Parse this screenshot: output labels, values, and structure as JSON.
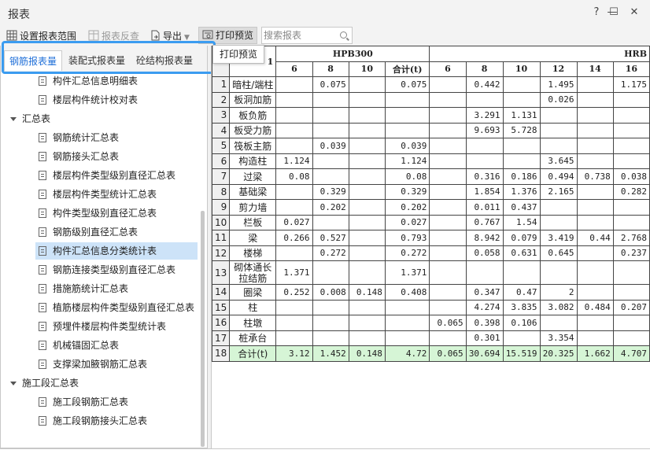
{
  "window": {
    "title": "报表"
  },
  "toolbar": {
    "set_range": "设置报表范围",
    "reverse_check": "报表反查",
    "export": "导出",
    "print_preview": "打印预览",
    "search_placeholder": "搜索报表"
  },
  "tooltip": "打印预览",
  "tabs": [
    "钢筋报表量",
    "装配式报表量",
    "砼结构报表量"
  ],
  "tree": {
    "items_top": [
      "构件汇总信息明细表",
      "楼层构件统计校对表"
    ],
    "group_summary": "汇总表",
    "summary_items": [
      "钢筋统计汇总表",
      "钢筋接头汇总表",
      "楼层构件类型级别直径汇总表",
      "楼层构件类型统计汇总表",
      "构件类型级别直径汇总表",
      "钢筋级别直径汇总表",
      "构件汇总信息分类统计表",
      "钢筋连接类型级别直径汇总表",
      "措施筋统计汇总表",
      "植筋楼层构件类型级别直径汇总表",
      "预埋件楼层构件类型统计表",
      "机械锚固汇总表",
      "支撑梁加腋钢筋汇总表"
    ],
    "group_stage": "施工段汇总表",
    "stage_items": [
      "施工段钢筋汇总表",
      "施工段钢筋接头汇总表"
    ],
    "selected": "构件汇总信息分类统计表"
  },
  "table": {
    "corner_fragment": "1",
    "group_hpb": "HPB300",
    "group_hrb": "HRB",
    "sub_headers": [
      "6",
      "8",
      "10",
      "合计(t)",
      "6",
      "8",
      "10",
      "12",
      "14",
      "16"
    ],
    "rows": [
      {
        "n": "1",
        "name": "暗柱/端柱",
        "v": [
          "",
          "0.075",
          "",
          "0.075",
          "",
          "0.442",
          "",
          "1.495",
          "",
          "1.175"
        ]
      },
      {
        "n": "2",
        "name": "板洞加筋",
        "v": [
          "",
          "",
          "",
          "",
          "",
          "",
          "",
          "0.026",
          "",
          ""
        ]
      },
      {
        "n": "3",
        "name": "板负筋",
        "v": [
          "",
          "",
          "",
          "",
          "",
          "3.291",
          "1.131",
          "",
          "",
          ""
        ]
      },
      {
        "n": "4",
        "name": "板受力筋",
        "v": [
          "",
          "",
          "",
          "",
          "",
          "9.693",
          "5.728",
          "",
          "",
          ""
        ]
      },
      {
        "n": "5",
        "name": "筏板主筋",
        "v": [
          "",
          "0.039",
          "",
          "0.039",
          "",
          "",
          "",
          "",
          "",
          ""
        ]
      },
      {
        "n": "6",
        "name": "构造柱",
        "v": [
          "1.124",
          "",
          "",
          "1.124",
          "",
          "",
          "",
          "3.645",
          "",
          ""
        ]
      },
      {
        "n": "7",
        "name": "过梁",
        "v": [
          "0.08",
          "",
          "",
          "0.08",
          "",
          "0.316",
          "0.186",
          "0.494",
          "0.738",
          "0.038"
        ]
      },
      {
        "n": "8",
        "name": "基础梁",
        "v": [
          "",
          "0.329",
          "",
          "0.329",
          "",
          "1.854",
          "1.376",
          "2.165",
          "",
          "0.282"
        ]
      },
      {
        "n": "9",
        "name": "剪力墙",
        "v": [
          "",
          "0.202",
          "",
          "0.202",
          "",
          "0.011",
          "0.437",
          "",
          "",
          ""
        ]
      },
      {
        "n": "10",
        "name": "栏板",
        "v": [
          "0.027",
          "",
          "",
          "0.027",
          "",
          "0.767",
          "1.54",
          "",
          "",
          ""
        ]
      },
      {
        "n": "11",
        "name": "梁",
        "v": [
          "0.266",
          "0.527",
          "",
          "0.793",
          "",
          "8.942",
          "0.079",
          "3.419",
          "0.44",
          "2.768"
        ]
      },
      {
        "n": "12",
        "name": "楼梯",
        "v": [
          "",
          "0.272",
          "",
          "0.272",
          "",
          "0.058",
          "0.631",
          "0.645",
          "",
          "0.237"
        ]
      },
      {
        "n": "13",
        "name": "砌体通长拉结筋",
        "v": [
          "1.371",
          "",
          "",
          "1.371",
          "",
          "",
          "",
          "",
          "",
          ""
        ],
        "tall": true
      },
      {
        "n": "14",
        "name": "圈梁",
        "v": [
          "0.252",
          "0.008",
          "0.148",
          "0.408",
          "",
          "0.347",
          "0.47",
          "2",
          "",
          ""
        ]
      },
      {
        "n": "15",
        "name": "柱",
        "v": [
          "",
          "",
          "",
          "",
          "",
          "4.274",
          "3.835",
          "3.082",
          "0.484",
          "0.207"
        ]
      },
      {
        "n": "16",
        "name": "柱墩",
        "v": [
          "",
          "",
          "",
          "",
          "0.065",
          "0.398",
          "0.106",
          "",
          "",
          ""
        ]
      },
      {
        "n": "17",
        "name": "桩承台",
        "v": [
          "",
          "",
          "",
          "",
          "",
          "0.301",
          "",
          "3.354",
          "",
          ""
        ]
      },
      {
        "n": "18",
        "name": "合计(t)",
        "v": [
          "3.12",
          "1.452",
          "0.148",
          "4.72",
          "0.065",
          "30.694",
          "15.519",
          "20.325",
          "1.662",
          "4.707"
        ],
        "total": true
      }
    ]
  },
  "colors": {
    "accent": "#1f6fd8",
    "highlight_box": "#3b9cf0",
    "total_row": "#d6f5d6",
    "selected_row": "#cde3f8"
  }
}
